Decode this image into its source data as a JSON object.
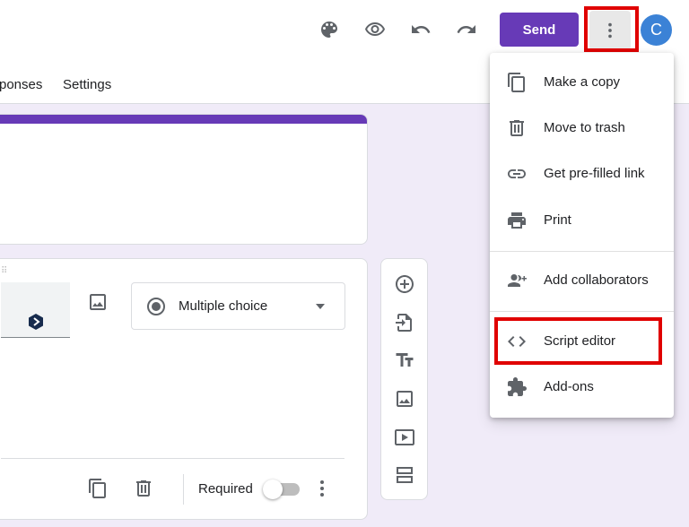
{
  "header": {
    "send_label": "Send",
    "avatar_initial": "C",
    "tabs": [
      "ponses",
      "Settings"
    ]
  },
  "question": {
    "type_label": "Multiple choice",
    "required_label": "Required",
    "required_on": false
  },
  "more_menu": {
    "items": [
      {
        "label": "Make a copy",
        "icon": "copy-icon"
      },
      {
        "label": "Move to trash",
        "icon": "trash-icon"
      },
      {
        "label": "Get pre-filled link",
        "icon": "link-icon"
      },
      {
        "label": "Print",
        "icon": "print-icon"
      },
      {
        "label": "Add collaborators",
        "icon": "add-people-icon"
      },
      {
        "label": "Script editor",
        "icon": "code-icon"
      },
      {
        "label": "Add-ons",
        "icon": "puzzle-icon"
      }
    ]
  },
  "colors": {
    "accent": "#673ab7",
    "highlight": "#e00000",
    "avatar": "#3b82d6",
    "background": "#f0ebf8"
  }
}
